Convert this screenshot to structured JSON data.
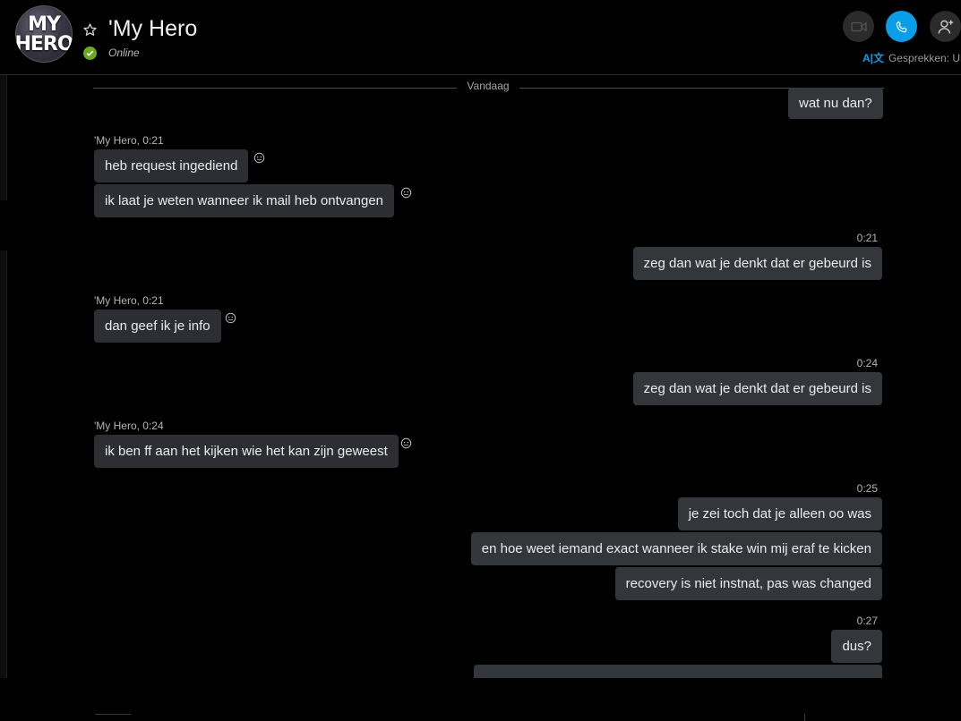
{
  "contact": {
    "avatar_line1": "MY",
    "avatar_line2": "HERO",
    "name": "'My Hero",
    "status": "Online"
  },
  "header": {
    "translate_label": "Gesprekken: Uit",
    "translate_icon": "translate-icon",
    "accent": "#0a9ee9",
    "status_color": "#6cab1f"
  },
  "chat": {
    "date_divider": "Vandaag",
    "messages": [
      {
        "dir": "out",
        "text": "wat nu dan?"
      },
      {
        "dir": "in",
        "meta": "'My Hero, 0:21",
        "text": "heb request ingediend"
      },
      {
        "dir": "in",
        "text": "ik laat je weten wanneer ik  mail heb ontvangen"
      },
      {
        "dir": "out",
        "meta": "0:21",
        "text": "zeg dan wat je denkt dat er gebeurd is"
      },
      {
        "dir": "in",
        "meta": "'My Hero, 0:21",
        "text": "dan geef ik je info"
      },
      {
        "dir": "out",
        "meta": "0:24",
        "text": "zeg dan wat je denkt dat er gebeurd is"
      },
      {
        "dir": "in",
        "meta": "'My Hero, 0:24",
        "text": "ik ben ff aan het kijken wie het kan zijn geweest"
      },
      {
        "dir": "out",
        "meta": "0:25",
        "text": "je zei toch dat je alleen oo was"
      },
      {
        "dir": "out",
        "text": "en hoe weet iemand exact wanneer ik stake win mij eraf te kicken"
      },
      {
        "dir": "out",
        "text": "recovery is niet instnat, pas was changed"
      },
      {
        "dir": "out",
        "meta": "0:27",
        "text": "dus?"
      }
    ]
  }
}
